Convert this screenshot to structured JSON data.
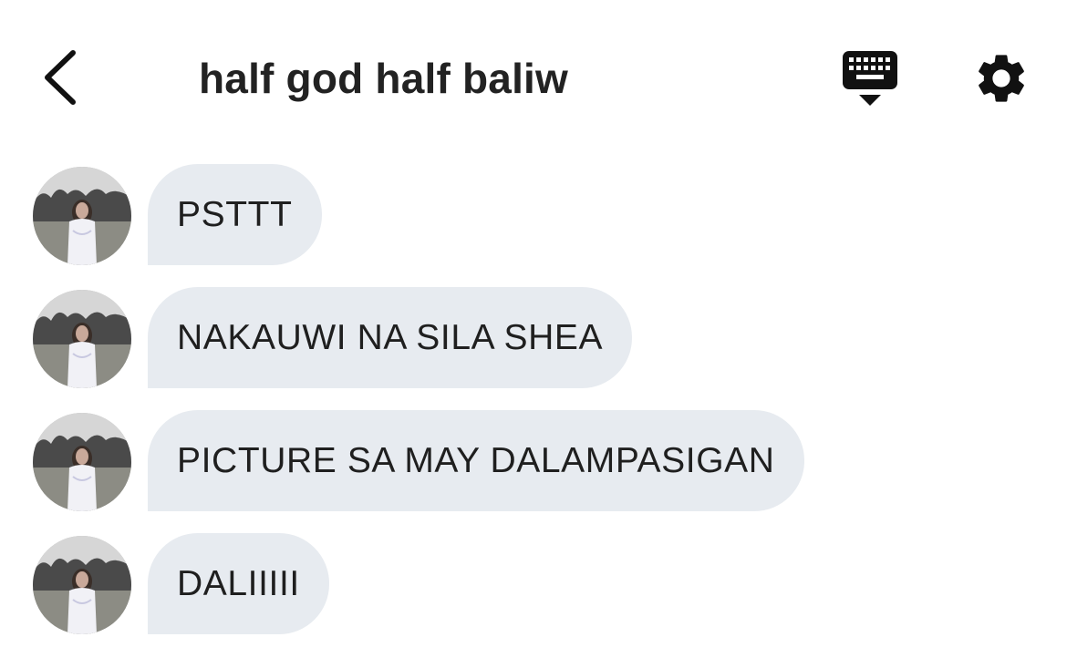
{
  "header": {
    "title": "half god half baliw",
    "back_icon": "chevron-left-icon",
    "keyboard_icon": "keyboard-hide-icon",
    "settings_icon": "gear-icon"
  },
  "messages": [
    {
      "text": "PSTTT"
    },
    {
      "text": "NAKAUWI NA SILA SHEA"
    },
    {
      "text": "PICTURE SA MAY DALAMPASIGAN"
    },
    {
      "text": "DALIIIII"
    }
  ],
  "colors": {
    "bubble_background": "#e7ebf0",
    "text": "#1f1f1f",
    "icon": "#111111"
  }
}
